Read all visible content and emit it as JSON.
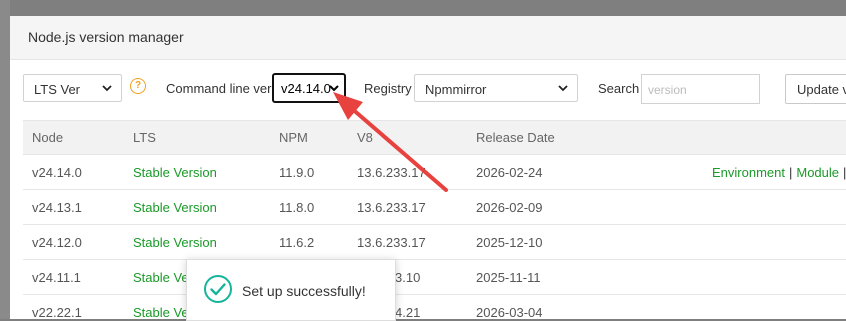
{
  "modal": {
    "title": "Node.js version manager"
  },
  "toolbar": {
    "lts_select": "LTS Ver",
    "help_glyph": "?",
    "cmd_label": "Command line ver",
    "cmd_select": "v24.14.0",
    "registry_label": "Registry",
    "registry_select": "Npmmirror",
    "search_label": "Search",
    "search_placeholder": "version",
    "update_button": "Update v"
  },
  "table": {
    "headers": [
      "Node",
      "LTS",
      "NPM",
      "V8",
      "Release Date"
    ],
    "rows": [
      {
        "node": "v24.14.0",
        "lts": "Stable Version",
        "npm": "11.9.0",
        "v8": "13.6.233.17",
        "date": "2026-02-24"
      },
      {
        "node": "v24.13.1",
        "lts": "Stable Version",
        "npm": "11.8.0",
        "v8": "13.6.233.17",
        "date": "2026-02-09"
      },
      {
        "node": "v24.12.0",
        "lts": "Stable Version",
        "npm": "11.6.2",
        "v8": "13.6.233.17",
        "date": "2025-12-10"
      },
      {
        "node": "v24.11.1",
        "lts": "Stable Ve",
        "npm": "",
        "v8": "3.10",
        "date": "2025-11-11"
      },
      {
        "node": "v22.22.1",
        "lts": "Stable Ve",
        "npm": "",
        "v8": "4.21",
        "date": "2026-03-04"
      }
    ],
    "actions": {
      "environment": "Environment",
      "separator": "|",
      "module": "Module"
    }
  },
  "toast": {
    "message": "Set up successfully!"
  },
  "colors": {
    "accent_green": "#1a9a28",
    "arrow_red": "#e8423f",
    "help_orange": "#f0a020"
  },
  "icons": [
    "chevron-down-icon",
    "help-icon",
    "check-circle-icon",
    "annotation-arrow"
  ]
}
